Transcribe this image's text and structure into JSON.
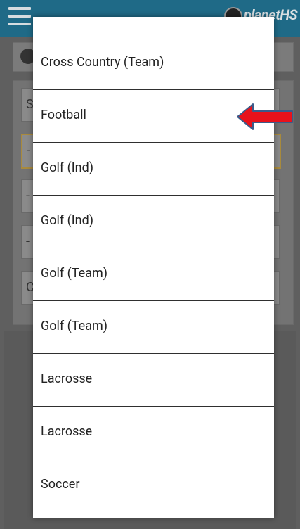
{
  "app": {
    "brand": "planetHS"
  },
  "background": {
    "fields": [
      {
        "first_char": "S"
      },
      {
        "first_char": "-"
      },
      {
        "first_char": "-"
      },
      {
        "first_char": "-"
      },
      {
        "first_char": "C"
      }
    ]
  },
  "dropdown": {
    "items": [
      {
        "label": ""
      },
      {
        "label": "Cross Country (Team)"
      },
      {
        "label": "Football"
      },
      {
        "label": "Golf (Ind)"
      },
      {
        "label": "Golf (Ind)"
      },
      {
        "label": "Golf (Team)"
      },
      {
        "label": "Golf (Team)"
      },
      {
        "label": "Lacrosse"
      },
      {
        "label": "Lacrosse"
      },
      {
        "label": "Soccer"
      }
    ]
  },
  "annotation": {
    "arrow_color": "#e8121b",
    "arrow_outline": "#3b5b8a",
    "points_to": "Football"
  }
}
